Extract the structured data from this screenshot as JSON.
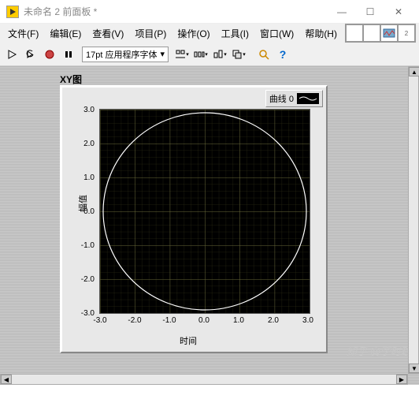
{
  "window": {
    "title": "未命名 2 前面板 *",
    "buttons": {
      "min": "—",
      "max": "☐",
      "close": "✕"
    }
  },
  "menu": {
    "file": "文件(F)",
    "edit": "编辑(E)",
    "view": "查看(V)",
    "project": "项目(P)",
    "operate": "操作(O)",
    "tools": "工具(I)",
    "window": "窗口(W)",
    "help": "帮助(H)"
  },
  "toolbar": {
    "font_label": "17pt 应用程序字体"
  },
  "panel": {
    "title": "XY图",
    "legend_label": "曲线 0",
    "xlabel": "时间",
    "ylabel": "幅值",
    "yticks": [
      "3.0",
      "2.0",
      "1.0",
      "0.0",
      "-1.0",
      "-2.0",
      "-3.0"
    ],
    "xticks": [
      "-3.0",
      "-2.0",
      "-1.0",
      "0.0",
      "1.0",
      "2.0",
      "3.0"
    ]
  },
  "watermark": "知乎 @李时珍",
  "chart_data": {
    "type": "line",
    "title": "XY图",
    "xlabel": "时间",
    "ylabel": "幅值",
    "xlim": [
      -3.0,
      3.0
    ],
    "ylim": [
      -3.0,
      3.0
    ],
    "grid": true,
    "series": [
      {
        "name": "曲线 0",
        "shape": "circle",
        "center_x": 0.0,
        "center_y": 0.0,
        "radius": 3.0
      }
    ],
    "xticks": [
      -3.0,
      -2.0,
      -1.0,
      0.0,
      1.0,
      2.0,
      3.0
    ],
    "yticks": [
      -3.0,
      -2.0,
      -1.0,
      0.0,
      1.0,
      2.0,
      3.0
    ]
  }
}
